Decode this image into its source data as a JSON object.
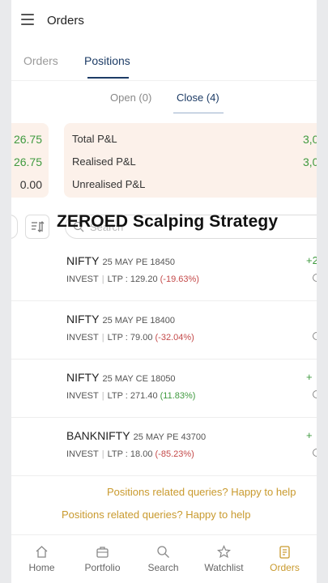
{
  "header": {
    "title": "Orders"
  },
  "main_tabs": [
    {
      "label": "Orders",
      "active": false
    },
    {
      "label": "Positions",
      "active": true
    }
  ],
  "sub_tabs": [
    {
      "label": "Open (0)",
      "active": false
    },
    {
      "label": "Close (4)",
      "active": true
    }
  ],
  "pnl_summary_left": [
    "26.75",
    "26.75",
    "0.00"
  ],
  "pnl_summary": [
    {
      "label": "Total P&L",
      "value": "3,0"
    },
    {
      "label": "Realised P&L",
      "value": "3,0"
    },
    {
      "label": "Unrealised P&L",
      "value": ""
    }
  ],
  "search": {
    "placeholder": "Search"
  },
  "overlay_title": "ZEROED Scalping Strategy",
  "positions": [
    {
      "symbol": "NIFTY",
      "contract": "25 MAY PE 18450",
      "product": "INVEST",
      "ltp_label": "LTP : 129.20",
      "change": "(-19.63%)",
      "change_dir": "neg",
      "pnl": "+2"
    },
    {
      "symbol": "NIFTY",
      "contract": "25 MAY PE 18400",
      "product": "INVEST",
      "ltp_label": "LTP : 79.00",
      "change": "(-32.04%)",
      "change_dir": "neg",
      "pnl": ""
    },
    {
      "symbol": "NIFTY",
      "contract": "25 MAY CE 18050",
      "product": "INVEST",
      "ltp_label": "LTP : 271.40",
      "change": "(11.83%)",
      "change_dir": "pos",
      "pnl": "+"
    },
    {
      "symbol": "BANKNIFTY",
      "contract": "25 MAY PE 43700",
      "product": "INVEST",
      "ltp_label": "LTP : 18.00",
      "change": "(-85.23%)",
      "change_dir": "neg",
      "pnl": "+"
    }
  ],
  "help_links": [
    "Positions related queries? Happy to help",
    "Positions related queries? Happy to help"
  ],
  "bottom_nav": [
    {
      "label": "Home",
      "icon": "home-icon",
      "active": false
    },
    {
      "label": "Portfolio",
      "icon": "briefcase-icon",
      "active": false
    },
    {
      "label": "Search",
      "icon": "search-icon",
      "active": false
    },
    {
      "label": "Watchlist",
      "icon": "star-icon",
      "active": false
    },
    {
      "label": "Orders",
      "icon": "orders-icon",
      "active": true
    }
  ],
  "colors": {
    "accent": "#1d3c66",
    "gold": "#c99a2e",
    "profit": "#3f9a3f",
    "loss": "#c44a4a",
    "pnl_bg": "#fcf1ea"
  }
}
